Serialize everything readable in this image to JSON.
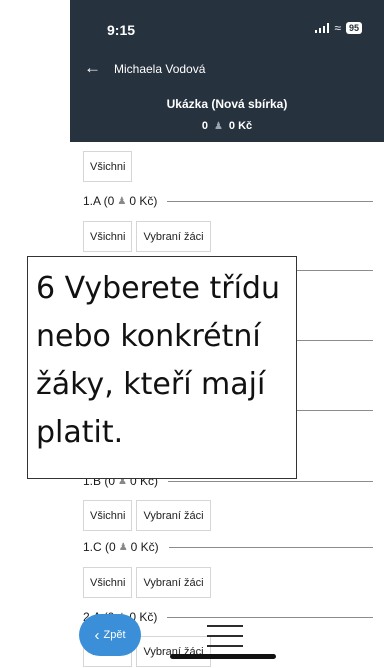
{
  "status_bar": {
    "time": "9:15",
    "battery": "95"
  },
  "header": {
    "person_name": "Michaela Vodová",
    "collection_title": "Ukázka (Nová sbírka)",
    "total_count": "0",
    "total_amount": "0 Kč"
  },
  "buttons": {
    "all": "Všichni",
    "selected": "Vybraní žáci"
  },
  "classes": [
    {
      "label": "1.A (0",
      "amount": "0 Kč)"
    },
    {
      "label": "1.B (0",
      "amount": "0 Kč)"
    },
    {
      "label": "1.C (0",
      "amount": "0 Kč)"
    },
    {
      "label": "2.A (0",
      "amount": "0 Kč)"
    }
  ],
  "tooltip": {
    "text": "6 Vyberete třídu nebo konkrétní žáky, kteří mají platit."
  },
  "footer": {
    "back_label": "Zpět"
  }
}
